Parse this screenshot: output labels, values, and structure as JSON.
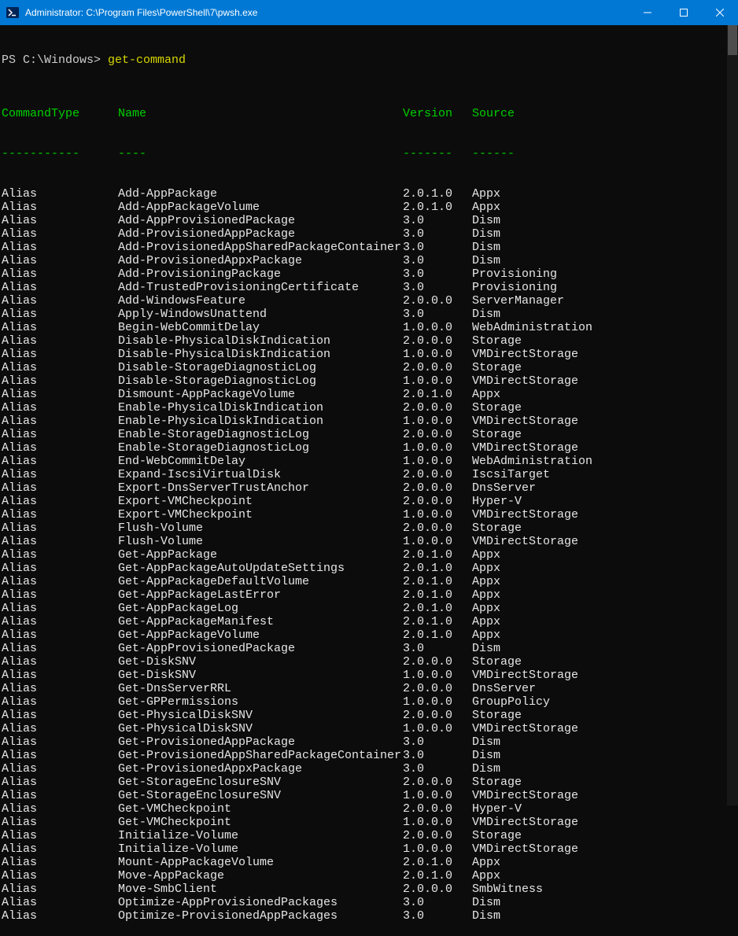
{
  "titlebar": {
    "title": "Administrator: C:\\Program Files\\PowerShell\\7\\pwsh.exe"
  },
  "prompt": {
    "path": "PS C:\\Windows> ",
    "command": "get-command"
  },
  "headers": {
    "type": "CommandType",
    "name": "Name",
    "version": "Version",
    "source": "Source",
    "dash_type": "-----------",
    "dash_name": "----",
    "dash_version": "-------",
    "dash_source": "------"
  },
  "rows": [
    {
      "type": "Alias",
      "name": "Add-AppPackage",
      "version": "2.0.1.0",
      "source": "Appx"
    },
    {
      "type": "Alias",
      "name": "Add-AppPackageVolume",
      "version": "2.0.1.0",
      "source": "Appx"
    },
    {
      "type": "Alias",
      "name": "Add-AppProvisionedPackage",
      "version": "3.0",
      "source": "Dism"
    },
    {
      "type": "Alias",
      "name": "Add-ProvisionedAppPackage",
      "version": "3.0",
      "source": "Dism"
    },
    {
      "type": "Alias",
      "name": "Add-ProvisionedAppSharedPackageContainer",
      "version": "3.0",
      "source": "Dism"
    },
    {
      "type": "Alias",
      "name": "Add-ProvisionedAppxPackage",
      "version": "3.0",
      "source": "Dism"
    },
    {
      "type": "Alias",
      "name": "Add-ProvisioningPackage",
      "version": "3.0",
      "source": "Provisioning"
    },
    {
      "type": "Alias",
      "name": "Add-TrustedProvisioningCertificate",
      "version": "3.0",
      "source": "Provisioning"
    },
    {
      "type": "Alias",
      "name": "Add-WindowsFeature",
      "version": "2.0.0.0",
      "source": "ServerManager"
    },
    {
      "type": "Alias",
      "name": "Apply-WindowsUnattend",
      "version": "3.0",
      "source": "Dism"
    },
    {
      "type": "Alias",
      "name": "Begin-WebCommitDelay",
      "version": "1.0.0.0",
      "source": "WebAdministration"
    },
    {
      "type": "Alias",
      "name": "Disable-PhysicalDiskIndication",
      "version": "2.0.0.0",
      "source": "Storage"
    },
    {
      "type": "Alias",
      "name": "Disable-PhysicalDiskIndication",
      "version": "1.0.0.0",
      "source": "VMDirectStorage"
    },
    {
      "type": "Alias",
      "name": "Disable-StorageDiagnosticLog",
      "version": "2.0.0.0",
      "source": "Storage"
    },
    {
      "type": "Alias",
      "name": "Disable-StorageDiagnosticLog",
      "version": "1.0.0.0",
      "source": "VMDirectStorage"
    },
    {
      "type": "Alias",
      "name": "Dismount-AppPackageVolume",
      "version": "2.0.1.0",
      "source": "Appx"
    },
    {
      "type": "Alias",
      "name": "Enable-PhysicalDiskIndication",
      "version": "2.0.0.0",
      "source": "Storage"
    },
    {
      "type": "Alias",
      "name": "Enable-PhysicalDiskIndication",
      "version": "1.0.0.0",
      "source": "VMDirectStorage"
    },
    {
      "type": "Alias",
      "name": "Enable-StorageDiagnosticLog",
      "version": "2.0.0.0",
      "source": "Storage"
    },
    {
      "type": "Alias",
      "name": "Enable-StorageDiagnosticLog",
      "version": "1.0.0.0",
      "source": "VMDirectStorage"
    },
    {
      "type": "Alias",
      "name": "End-WebCommitDelay",
      "version": "1.0.0.0",
      "source": "WebAdministration"
    },
    {
      "type": "Alias",
      "name": "Expand-IscsiVirtualDisk",
      "version": "2.0.0.0",
      "source": "IscsiTarget"
    },
    {
      "type": "Alias",
      "name": "Export-DnsServerTrustAnchor",
      "version": "2.0.0.0",
      "source": "DnsServer"
    },
    {
      "type": "Alias",
      "name": "Export-VMCheckpoint",
      "version": "2.0.0.0",
      "source": "Hyper-V"
    },
    {
      "type": "Alias",
      "name": "Export-VMCheckpoint",
      "version": "1.0.0.0",
      "source": "VMDirectStorage"
    },
    {
      "type": "Alias",
      "name": "Flush-Volume",
      "version": "2.0.0.0",
      "source": "Storage"
    },
    {
      "type": "Alias",
      "name": "Flush-Volume",
      "version": "1.0.0.0",
      "source": "VMDirectStorage"
    },
    {
      "type": "Alias",
      "name": "Get-AppPackage",
      "version": "2.0.1.0",
      "source": "Appx"
    },
    {
      "type": "Alias",
      "name": "Get-AppPackageAutoUpdateSettings",
      "version": "2.0.1.0",
      "source": "Appx"
    },
    {
      "type": "Alias",
      "name": "Get-AppPackageDefaultVolume",
      "version": "2.0.1.0",
      "source": "Appx"
    },
    {
      "type": "Alias",
      "name": "Get-AppPackageLastError",
      "version": "2.0.1.0",
      "source": "Appx"
    },
    {
      "type": "Alias",
      "name": "Get-AppPackageLog",
      "version": "2.0.1.0",
      "source": "Appx"
    },
    {
      "type": "Alias",
      "name": "Get-AppPackageManifest",
      "version": "2.0.1.0",
      "source": "Appx"
    },
    {
      "type": "Alias",
      "name": "Get-AppPackageVolume",
      "version": "2.0.1.0",
      "source": "Appx"
    },
    {
      "type": "Alias",
      "name": "Get-AppProvisionedPackage",
      "version": "3.0",
      "source": "Dism"
    },
    {
      "type": "Alias",
      "name": "Get-DiskSNV",
      "version": "2.0.0.0",
      "source": "Storage"
    },
    {
      "type": "Alias",
      "name": "Get-DiskSNV",
      "version": "1.0.0.0",
      "source": "VMDirectStorage"
    },
    {
      "type": "Alias",
      "name": "Get-DnsServerRRL",
      "version": "2.0.0.0",
      "source": "DnsServer"
    },
    {
      "type": "Alias",
      "name": "Get-GPPermissions",
      "version": "1.0.0.0",
      "source": "GroupPolicy"
    },
    {
      "type": "Alias",
      "name": "Get-PhysicalDiskSNV",
      "version": "2.0.0.0",
      "source": "Storage"
    },
    {
      "type": "Alias",
      "name": "Get-PhysicalDiskSNV",
      "version": "1.0.0.0",
      "source": "VMDirectStorage"
    },
    {
      "type": "Alias",
      "name": "Get-ProvisionedAppPackage",
      "version": "3.0",
      "source": "Dism"
    },
    {
      "type": "Alias",
      "name": "Get-ProvisionedAppSharedPackageContainer",
      "version": "3.0",
      "source": "Dism"
    },
    {
      "type": "Alias",
      "name": "Get-ProvisionedAppxPackage",
      "version": "3.0",
      "source": "Dism"
    },
    {
      "type": "Alias",
      "name": "Get-StorageEnclosureSNV",
      "version": "2.0.0.0",
      "source": "Storage"
    },
    {
      "type": "Alias",
      "name": "Get-StorageEnclosureSNV",
      "version": "1.0.0.0",
      "source": "VMDirectStorage"
    },
    {
      "type": "Alias",
      "name": "Get-VMCheckpoint",
      "version": "2.0.0.0",
      "source": "Hyper-V"
    },
    {
      "type": "Alias",
      "name": "Get-VMCheckpoint",
      "version": "1.0.0.0",
      "source": "VMDirectStorage"
    },
    {
      "type": "Alias",
      "name": "Initialize-Volume",
      "version": "2.0.0.0",
      "source": "Storage"
    },
    {
      "type": "Alias",
      "name": "Initialize-Volume",
      "version": "1.0.0.0",
      "source": "VMDirectStorage"
    },
    {
      "type": "Alias",
      "name": "Mount-AppPackageVolume",
      "version": "2.0.1.0",
      "source": "Appx"
    },
    {
      "type": "Alias",
      "name": "Move-AppPackage",
      "version": "2.0.1.0",
      "source": "Appx"
    },
    {
      "type": "Alias",
      "name": "Move-SmbClient",
      "version": "2.0.0.0",
      "source": "SmbWitness"
    },
    {
      "type": "Alias",
      "name": "Optimize-AppProvisionedPackages",
      "version": "3.0",
      "source": "Dism"
    },
    {
      "type": "Alias",
      "name": "Optimize-ProvisionedAppPackages",
      "version": "3.0",
      "source": "Dism"
    }
  ]
}
